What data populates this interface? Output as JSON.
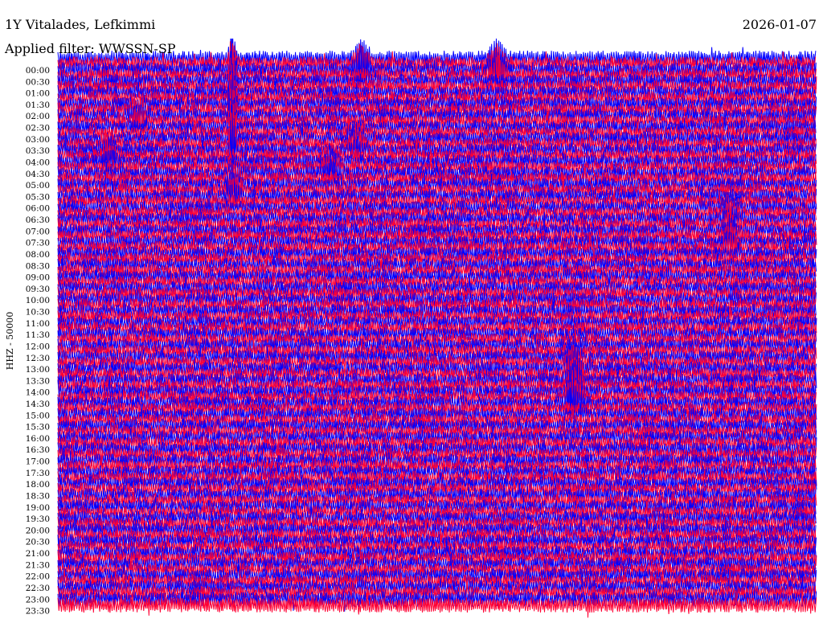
{
  "header": {
    "station": "1Y Vitalades, Lefkimmi",
    "date": "2026-01-07",
    "filter": "Applied filter: WWSSN-SP"
  },
  "chart_data": {
    "type": "line",
    "title": "1Y Vitalades, Lefkimmi",
    "subtitle": "Applied filter: WWSSN-SP",
    "date": "2026-01-07",
    "ylabel": "HHZ - 50000",
    "xlabel": "",
    "y_ticks": [
      "00:00",
      "00:30",
      "01:00",
      "01:30",
      "02:00",
      "02:30",
      "03:00",
      "03:30",
      "04:00",
      "04:30",
      "05:00",
      "05:30",
      "06:00",
      "06:30",
      "07:00",
      "07:30",
      "08:00",
      "08:30",
      "09:00",
      "09:30",
      "10:00",
      "10:30",
      "11:00",
      "11:30",
      "12:00",
      "12:30",
      "13:00",
      "13:30",
      "14:00",
      "14:30",
      "15:00",
      "15:30",
      "16:00",
      "16:30",
      "17:00",
      "17:30",
      "18:00",
      "18:30",
      "19:00",
      "19:30",
      "20:00",
      "20:30",
      "21:00",
      "21:30",
      "22:00",
      "22:30",
      "23:00",
      "23:30"
    ],
    "row_interval_minutes": 15,
    "row_count": 96,
    "minutes_per_row": 15,
    "colors": [
      "#0000ff",
      "#ff0033"
    ],
    "grid": false,
    "legend": "none",
    "events": [
      {
        "row_start": 0,
        "row_end": 2,
        "minute": 6.0,
        "amplitude": "large",
        "color": "#ff0033"
      },
      {
        "row_start": 0,
        "row_end": 16,
        "minute": 3.45,
        "amplitude": "very large",
        "color": "#0000ff"
      },
      {
        "row_start": 0,
        "row_end": 3,
        "minute": 8.7,
        "amplitude": "large",
        "color": "#ff0033"
      },
      {
        "row_start": 9,
        "row_end": 11,
        "minute": 1.6,
        "amplitude": "medium",
        "color": "#ff0033"
      },
      {
        "row_start": 13,
        "row_end": 16,
        "minute": 5.9,
        "amplitude": "medium",
        "color": "#0000ff"
      },
      {
        "row_start": 15,
        "row_end": 18,
        "minute": 1.0,
        "amplitude": "medium",
        "color": "#ff0033"
      },
      {
        "row_start": 17,
        "row_end": 20,
        "minute": 5.4,
        "amplitude": "medium",
        "color": "#ff0033"
      },
      {
        "row_start": 20,
        "row_end": 24,
        "minute": 3.5,
        "amplitude": "medium",
        "color": "#ff0033"
      },
      {
        "row_start": 26,
        "row_end": 33,
        "minute": 13.3,
        "amplitude": "medium",
        "color": "#ff0033"
      },
      {
        "row_start": 52,
        "row_end": 60,
        "minute": 10.2,
        "amplitude": "large",
        "color": "#0000ff"
      }
    ]
  }
}
